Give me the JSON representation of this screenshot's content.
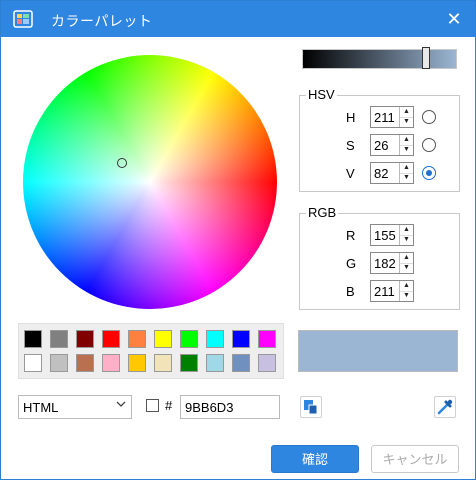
{
  "window": {
    "title": "カラーパレット",
    "close_symbol": "✕"
  },
  "value_slider": {
    "value": 82,
    "max": 100
  },
  "hsv": {
    "title": "HSV",
    "fields": [
      {
        "label": "H",
        "value": "211",
        "selected": false
      },
      {
        "label": "S",
        "value": "26",
        "selected": false
      },
      {
        "label": "V",
        "value": "82",
        "selected": true
      }
    ]
  },
  "rgb": {
    "title": "RGB",
    "fields": [
      {
        "label": "R",
        "value": "155"
      },
      {
        "label": "G",
        "value": "182"
      },
      {
        "label": "B",
        "value": "211"
      }
    ]
  },
  "palette": {
    "row1": [
      "#000000",
      "#808080",
      "#800000",
      "#ff0000",
      "#ff8040",
      "#ffff00",
      "#00ff00",
      "#00ffff",
      "#0000ff",
      "#ff00ff"
    ],
    "row2": [
      "#ffffff",
      "#c0c0c0",
      "#b87050",
      "#ffb0c8",
      "#ffc800",
      "#f0e4b8",
      "#008000",
      "#a0d8e8",
      "#7090c0",
      "#c8c0e0"
    ]
  },
  "preview_color": "#9BB6D3",
  "format": {
    "selected": "HTML"
  },
  "hex": {
    "hash": "#",
    "value": "9BB6D3",
    "checked": false
  },
  "buttons": {
    "ok": "確認",
    "cancel": "キャンセル"
  },
  "icons": {
    "app": "palette-icon",
    "copy": "copy-icon",
    "picker": "eyedropper-icon"
  }
}
